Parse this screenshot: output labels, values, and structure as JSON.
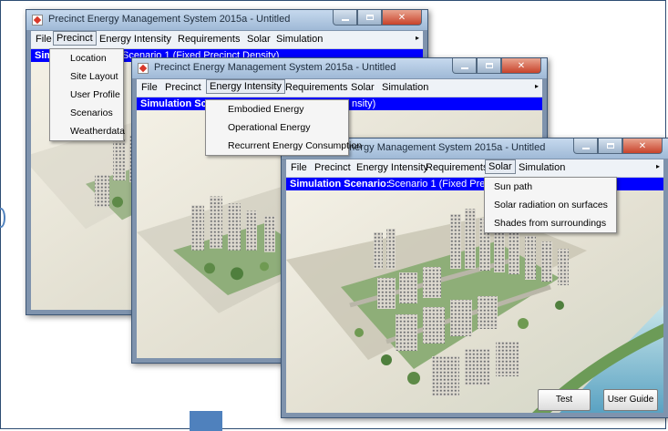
{
  "app": {
    "title": "Precinct Energy Management System 2015a  -  Untitled"
  },
  "menubar": {
    "file": "File",
    "precinct": "Precinct",
    "energy_intensity": "Energy Intensity",
    "requirements": "Requirements",
    "solar": "Solar",
    "simulation": "Simulation"
  },
  "window1": {
    "scenario_label": "Simu",
    "scenario_value": "Scenario 1 (Fixed Precinct Density)",
    "precinct_menu": [
      "Location",
      "Site Layout",
      "User Profile",
      "Scenarios",
      "Weatherdata"
    ]
  },
  "window2": {
    "scenario_label": "Simulation Sc",
    "scenario_value": "nsity)",
    "energy_menu": [
      "Embodied Energy",
      "Operational Energy",
      "Recurrent Energy Consumption"
    ]
  },
  "window3": {
    "scenario_label": "Simulation Scenario:",
    "scenario_value": "Scenario 1 (Fixed Preci",
    "solar_menu": [
      "Sun path",
      "Solar radiation on surfaces",
      "Shades from surroundings"
    ],
    "test_button": "Test",
    "guide_button": "User Guide"
  },
  "colors": {
    "scenario_bar": "#0000ff",
    "frame_border": "#2e4d73",
    "accent": "#4f81bd"
  }
}
